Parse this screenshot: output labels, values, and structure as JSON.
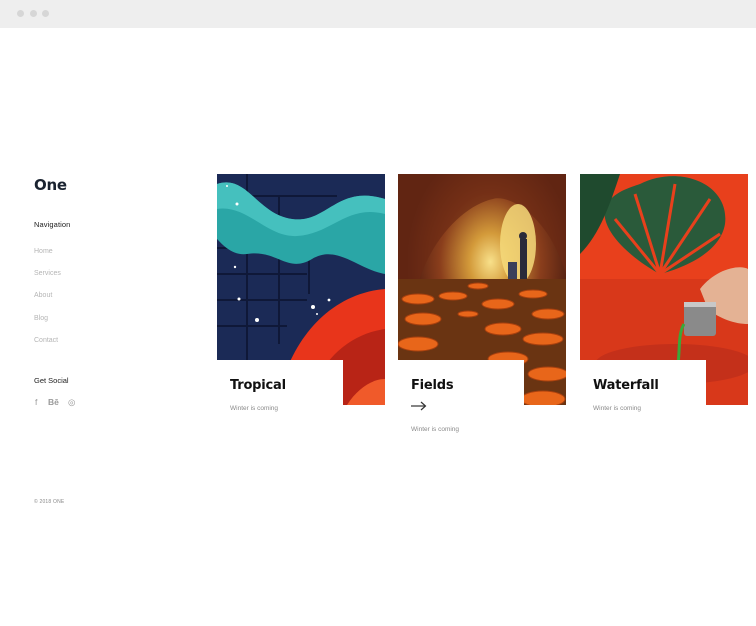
{
  "logo": "One",
  "navigation": {
    "heading": "Navigation",
    "items": [
      "Home",
      "Services",
      "About",
      "Blog",
      "Contact"
    ]
  },
  "social": {
    "heading": "Get Social",
    "icons": [
      {
        "name": "facebook-icon",
        "glyph": "f"
      },
      {
        "name": "behance-icon",
        "glyph": "Bē"
      },
      {
        "name": "instagram-icon",
        "glyph": "◎"
      }
    ]
  },
  "copyright": "© 2018 ONE",
  "cards": [
    {
      "title": "Tropical",
      "subtitle": "Winter is coming",
      "has_arrow": false
    },
    {
      "title": "Fields",
      "subtitle": "Winter is coming",
      "has_arrow": true
    },
    {
      "title": "Waterfall",
      "subtitle": "Winter is coming",
      "has_arrow": false
    }
  ],
  "colors": {
    "accent_red": "#e8351b",
    "accent_orange": "#e86a18",
    "teal": "#2aa6a6",
    "navy": "#1d2a55"
  }
}
